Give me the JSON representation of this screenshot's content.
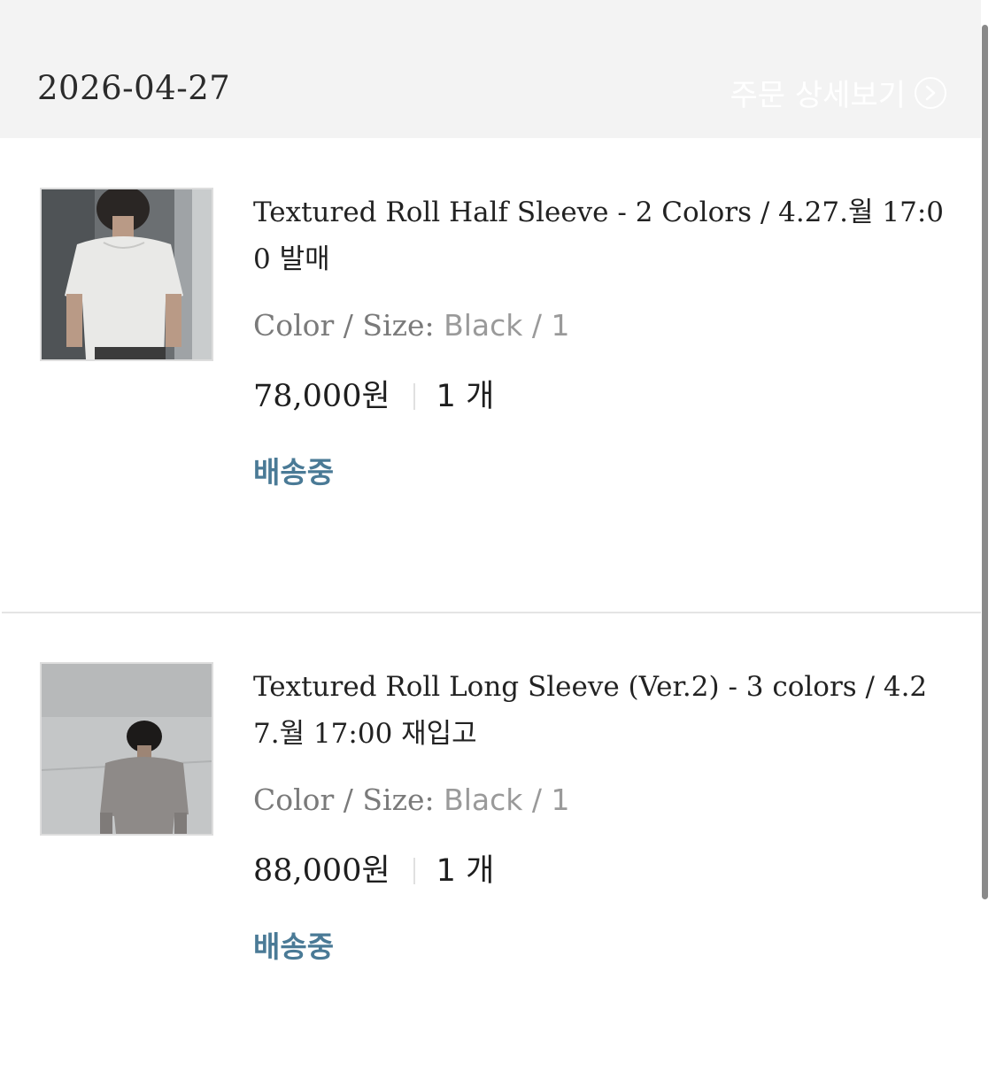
{
  "order": {
    "date": "2026-04-27",
    "detail_link_label": "주문 상세보기"
  },
  "items": [
    {
      "name": "Textured Roll Half Sleeve - 2 Colors / 4.27.월 17:00 발매",
      "option_label": "Color / Size:",
      "option_value": "Black / 1",
      "price": "78,000원",
      "quantity": "1 개",
      "status": "배송중",
      "image": "white-tshirt-model-photo"
    },
    {
      "name": "Textured Roll Long Sleeve (Ver.2) - 3 colors / 4.27.월 17:00 재입고",
      "option_label": "Color / Size:",
      "option_value": "Black / 1",
      "price": "88,000원",
      "quantity": "1 개",
      "status": "배송중",
      "image": "grey-longsleeve-model-photo"
    }
  ],
  "colors": {
    "header_bg": "#f3f3f3",
    "status": "#4a7a96",
    "option_text": "#8a8a8a"
  }
}
